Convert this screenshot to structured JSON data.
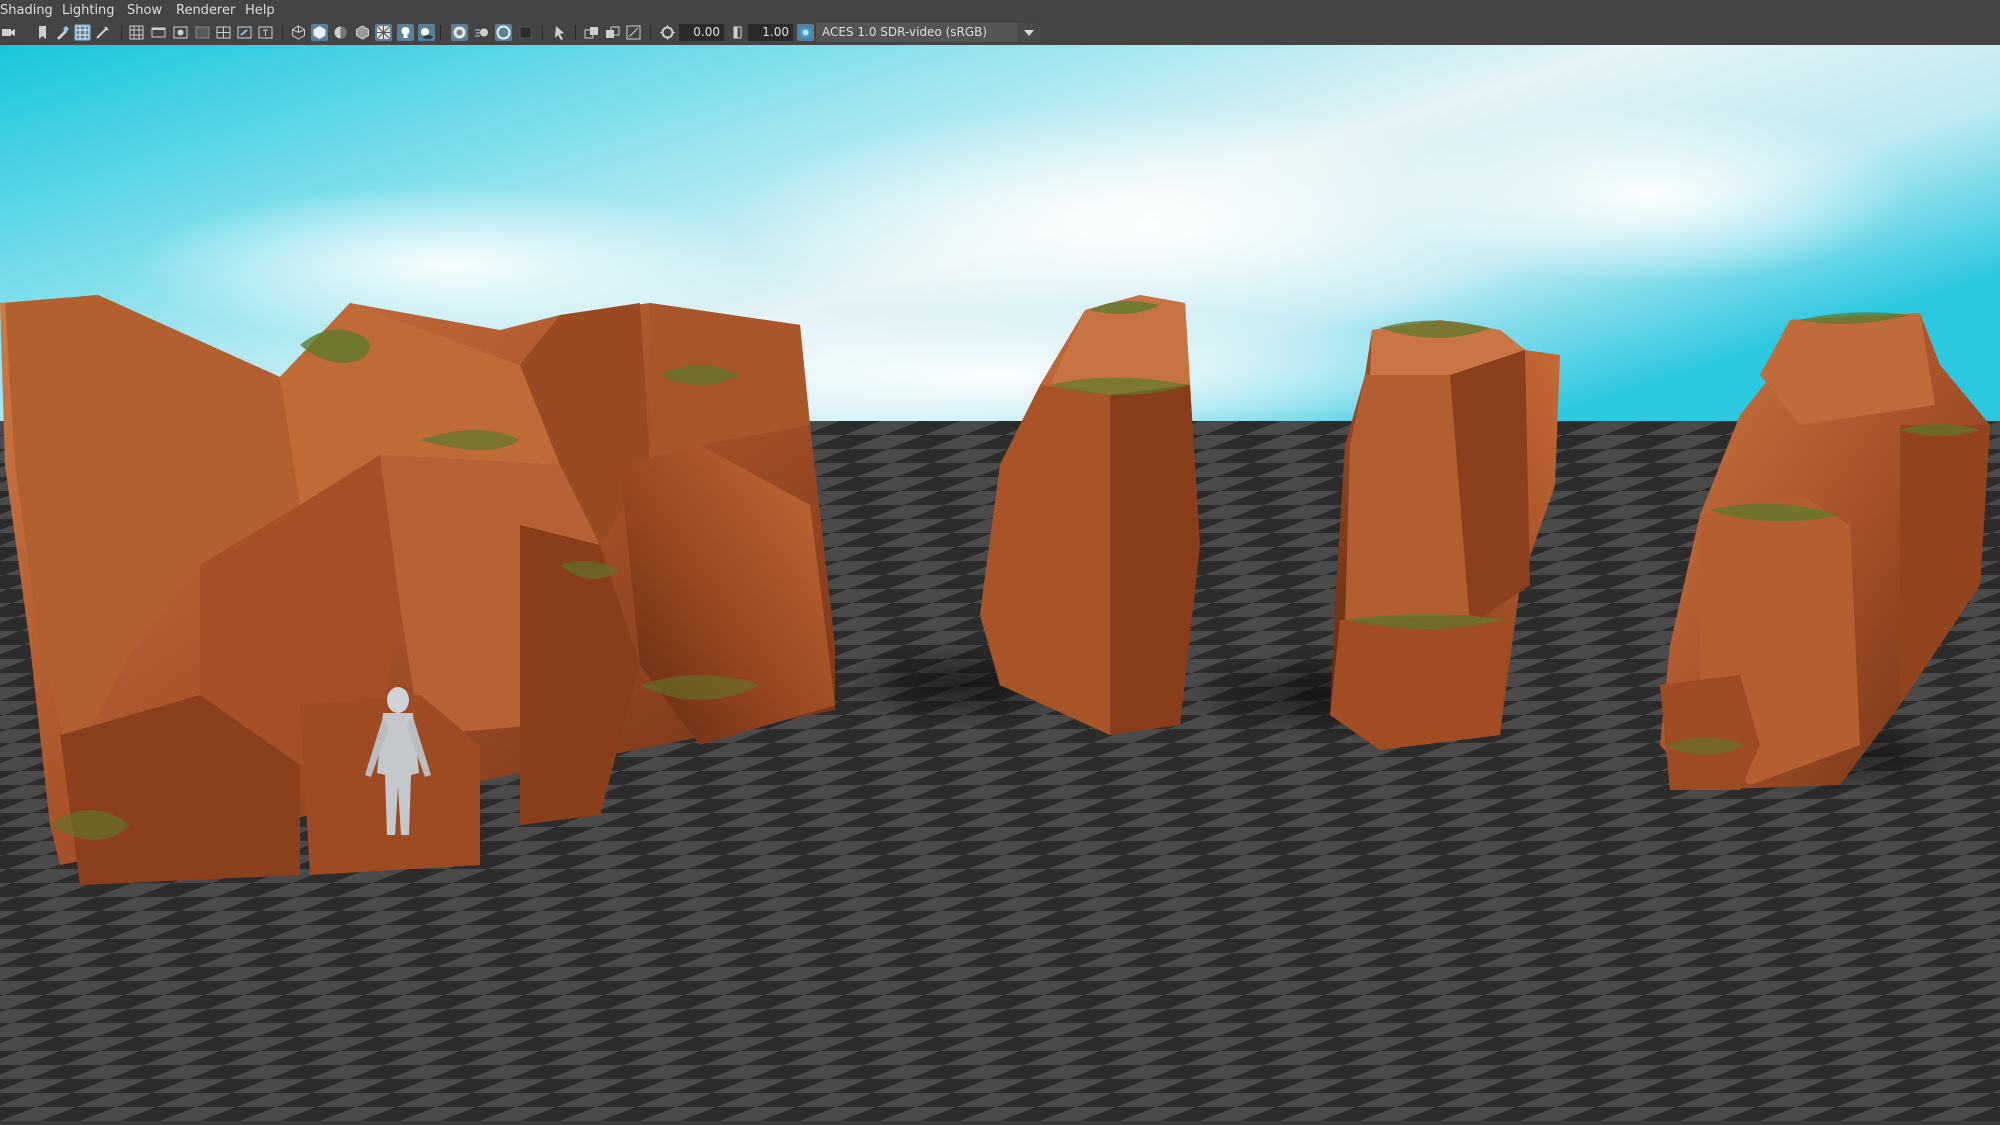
{
  "menubar": {
    "items": [
      {
        "label": "Shading"
      },
      {
        "label": "Lighting"
      },
      {
        "label": "Show"
      },
      {
        "label": "Renderer"
      },
      {
        "label": "Help"
      }
    ]
  },
  "toolbar": {
    "exposure_value": "0.00",
    "gamma_value": "1.00",
    "color_space": "ACES 1.0 SDR-video (sRGB)",
    "icons": [
      "camera-select-icon",
      "bookmark-icon",
      "camera-tools-icon",
      "grid-icon",
      "film-gate-icon",
      "resolution-gate-icon",
      "gate-mask-icon",
      "field-chart-icon",
      "safe-action-icon",
      "safe-title-icon",
      "wireframe-icon",
      "smooth-shade-icon",
      "default-material-icon",
      "textured-icon",
      "wireframe-on-shaded-icon",
      "use-all-lights-icon",
      "shadows-icon",
      "screen-space-ao-icon",
      "motion-blur-icon",
      "anti-aliasing-icon",
      "depth-of-field-icon",
      "isolate-select-icon",
      "xray-icon",
      "xray-joints-icon",
      "backface-culling-icon",
      "exposure-icon",
      "gamma-icon",
      "color-management-icon"
    ]
  },
  "viewport": {
    "sky_colors": [
      "#18c8dc",
      "#7fe0ec",
      "#d6eef2"
    ],
    "rock_colors": [
      "#9a4a22",
      "#c06a36",
      "#6b2e14",
      "#d48650"
    ],
    "moss_color": "#5c7a2c",
    "grid_dark": "#2c2c2c",
    "grid_light": "#4a4a4a"
  }
}
